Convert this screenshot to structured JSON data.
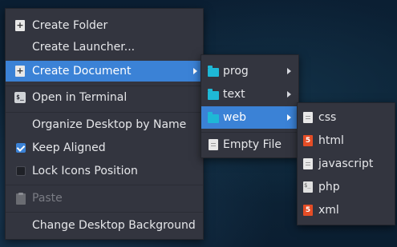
{
  "main_menu": {
    "items": [
      {
        "label": "Create Folder",
        "icon": "folder-add-icon"
      },
      {
        "label": "Create Launcher...",
        "icon": ""
      },
      {
        "label": "Create Document",
        "icon": "document-add-icon"
      },
      {
        "label": "Open in Terminal",
        "icon": "terminal-icon"
      },
      {
        "label": "Organize Desktop by Name",
        "icon": ""
      },
      {
        "label": "Keep Aligned",
        "icon": "checkbox-checked-icon",
        "checked": true
      },
      {
        "label": "Lock Icons Position",
        "icon": "checkbox-unchecked-icon",
        "checked": false
      },
      {
        "label": "Paste",
        "icon": "paste-icon",
        "disabled": true
      },
      {
        "label": "Change Desktop Background",
        "icon": ""
      }
    ]
  },
  "document_menu": {
    "items": [
      {
        "label": "prog",
        "icon": "folder-icon"
      },
      {
        "label": "text",
        "icon": "folder-icon"
      },
      {
        "label": "web",
        "icon": "folder-icon"
      },
      {
        "label": "Empty File",
        "icon": "text-file-icon"
      }
    ]
  },
  "web_menu": {
    "items": [
      {
        "label": "css",
        "icon": "text-file-icon"
      },
      {
        "label": "html",
        "icon": "html5-icon"
      },
      {
        "label": "javascript",
        "icon": "text-file-icon"
      },
      {
        "label": "php",
        "icon": "script-file-icon"
      },
      {
        "label": "xml",
        "icon": "html5-icon"
      }
    ]
  },
  "colors": {
    "menu_bg": "#33353f",
    "highlight": "#3b82d6",
    "folder": "#1eb8d6",
    "html5": "#e44d26"
  }
}
